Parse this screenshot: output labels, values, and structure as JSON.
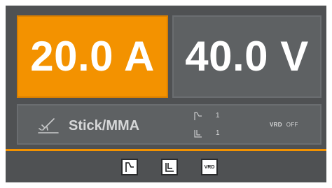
{
  "display": {
    "current_value": "20.0 A",
    "voltage_value": "40.0 V"
  },
  "mode": {
    "label": "Stick/MMA",
    "icon": "stick-electrode-icon",
    "params": [
      {
        "icon": "hot-start-icon",
        "value": "1"
      },
      {
        "icon": "arc-force-icon",
        "value": "1"
      }
    ],
    "vrd_label": "VRD",
    "vrd_state": "OFF"
  },
  "buttons": [
    {
      "icon": "hot-start-icon"
    },
    {
      "icon": "arc-force-icon"
    },
    {
      "icon": "vrd-icon",
      "label": "VRD"
    }
  ],
  "colors": {
    "accent": "#f39200",
    "panel": "#5e6163",
    "frame": "#4f5153",
    "text": "#ffffff",
    "muted_text": "#d6d7d8"
  }
}
